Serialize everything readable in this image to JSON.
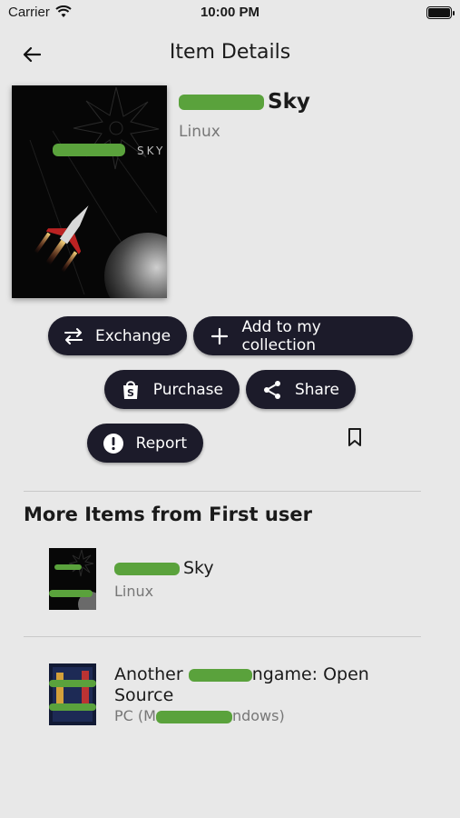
{
  "status_bar": {
    "carrier": "Carrier",
    "time": "10:00 PM"
  },
  "header": {
    "title": "Item Details"
  },
  "item": {
    "name_suffix": "Sky",
    "platform": "Linux",
    "cover_text": "SKY"
  },
  "actions": {
    "exchange": "Exchange",
    "add_collection": "Add to my collection",
    "purchase": "Purchase",
    "share": "Share",
    "report": "Report"
  },
  "more": {
    "title": "More Items from First user",
    "items": [
      {
        "title_suffix": "Sky",
        "platform": "Linux"
      },
      {
        "title_prefix": "Another",
        "title_mid": "ngame: Open",
        "title_line2": "Source",
        "platform_prefix": "PC (M",
        "platform_suffix": "ndows)"
      }
    ]
  },
  "colors": {
    "button_bg": "#1c1b2a",
    "page_bg": "#e8e8e8",
    "scribble": "#5aa23c"
  }
}
